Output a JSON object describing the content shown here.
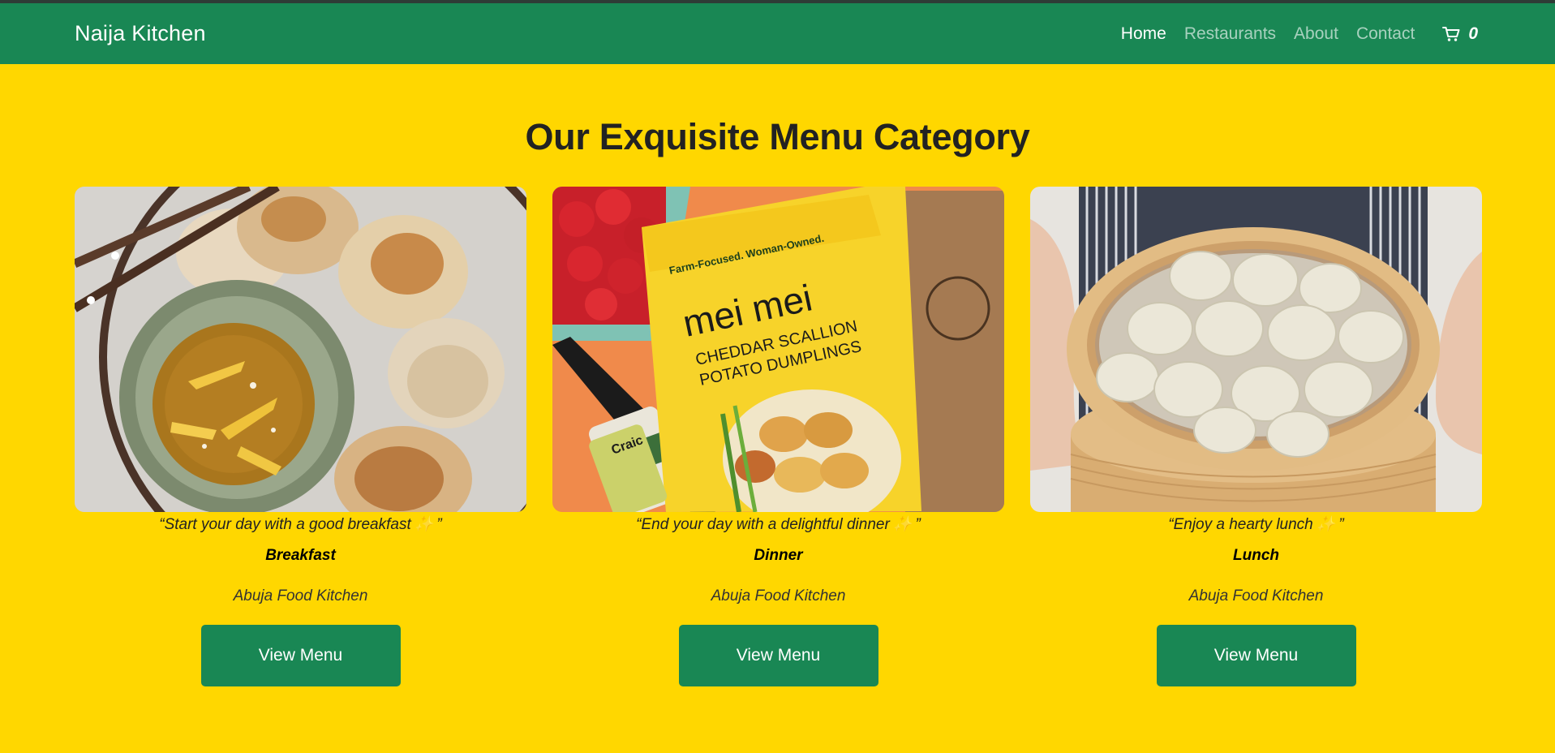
{
  "brand": "Naija Kitchen",
  "nav": {
    "items": [
      {
        "label": "Home",
        "active": true
      },
      {
        "label": "Restaurants",
        "active": false
      },
      {
        "label": "About",
        "active": false
      },
      {
        "label": "Contact",
        "active": false
      }
    ],
    "cart_icon": "cart-icon",
    "cart_count": "0"
  },
  "heading": "Our Exquisite Menu Category",
  "cards": [
    {
      "image": "dumplings-with-dipping-sauce",
      "quote_open": "“Start your day with a good breakfast",
      "quote_close": "”",
      "category": "Breakfast",
      "kitchen": "Abuja Food Kitchen",
      "button": "View Menu"
    },
    {
      "image": "packaged-dumplings-flatlay",
      "quote_open": "“End your day with a delightful dinner",
      "quote_close": "”",
      "category": "Dinner",
      "kitchen": "Abuja Food Kitchen",
      "button": "View Menu"
    },
    {
      "image": "dumplings-in-steamer-basket",
      "quote_open": "“Enjoy a hearty lunch",
      "quote_close": "”",
      "category": "Lunch",
      "kitchen": "Abuja Food Kitchen",
      "button": "View Menu"
    }
  ],
  "image_text": {
    "bag_tagline": "Farm-Focused. Woman-Owned.",
    "bag_brand": "mei mei",
    "bag_product_1": "CHEDDAR SCALLION",
    "bag_product_2": "POTATO DUMPLINGS",
    "bottle_label": "Craic"
  },
  "colors": {
    "page_bg": "#FFD700",
    "nav_bg": "#198754",
    "button_bg": "#198754"
  }
}
